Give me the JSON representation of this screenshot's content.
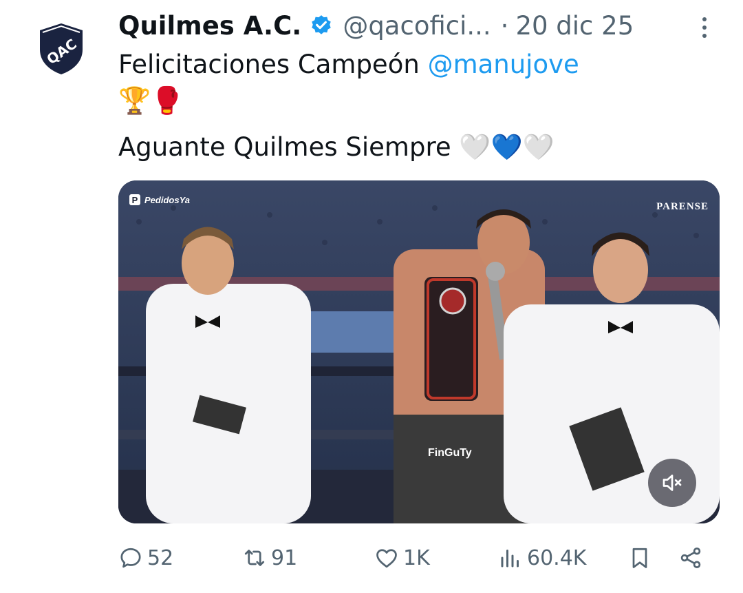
{
  "tweet": {
    "author": {
      "display_name": "Quilmes A.C.",
      "handle": "@qacofici...",
      "avatar_text": "QAC",
      "verified": true
    },
    "date_separator": "·",
    "date": "20 dic 25",
    "text": {
      "line1": "Felicitaciones Campeón",
      "mention": "@manujove",
      "line2_emojis": "🏆🥊",
      "line3": "Aguante Quilmes Siempre",
      "line3_emojis": "🤍💙🤍"
    },
    "media": {
      "brand_left": "PedidosYa",
      "brand_right": "PARENSE",
      "shorts_text": "FinGuTy",
      "mute_icon": "speaker-muted-icon"
    },
    "actions": {
      "replies": "52",
      "reposts": "91",
      "likes": "1K",
      "views": "60.4K"
    }
  },
  "colors": {
    "accent": "#1d9bf0",
    "text": "#0f1419",
    "muted": "#536471",
    "verified_badge": "#1d9bf0"
  }
}
